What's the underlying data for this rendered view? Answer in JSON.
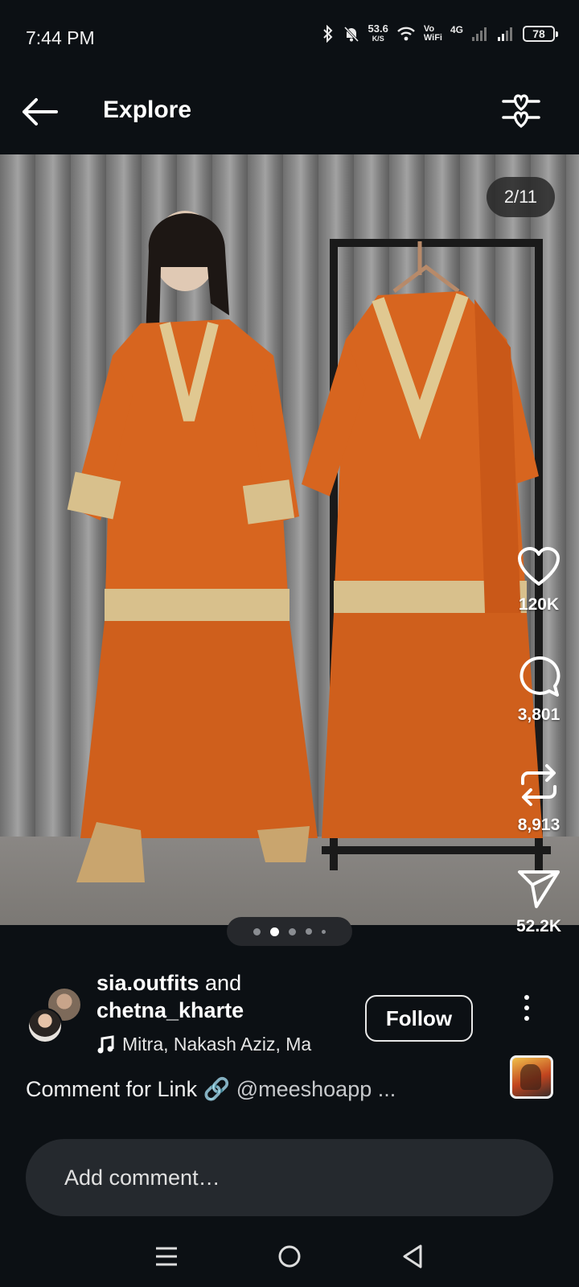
{
  "status_bar": {
    "time": "7:44 PM",
    "net_speed": "53.6",
    "net_unit": "K/S",
    "vo": "Vo",
    "wifi": "WiFi",
    "cell": "4G",
    "battery": "78"
  },
  "header": {
    "title": "Explore"
  },
  "media": {
    "page_indicator": "2/11",
    "page_current": 2,
    "page_total": 11
  },
  "actions": {
    "likes": "120K",
    "comments": "3,801",
    "reposts": "8,913",
    "shares": "52.2K"
  },
  "carousel": {
    "dot_count": 5,
    "active_index": 1
  },
  "author": {
    "name_1": "sia.outfits",
    "joiner": "and",
    "name_2": "chetna_kharte",
    "music": "Mitra, Nakash Aziz, Ma",
    "follow_label": "Follow"
  },
  "caption": {
    "text": "Comment for Link 🔗",
    "mention": "@meeshoapp",
    "ellipsis": "..."
  },
  "comment": {
    "placeholder": "Add comment…"
  },
  "icons": {
    "back": "back-arrow-icon",
    "filter": "filter-heart-icon",
    "like": "heart-icon",
    "comment": "comment-bubble-icon",
    "repost": "repost-icon",
    "share": "send-icon",
    "music": "music-note-icon"
  },
  "colors": {
    "background": "#0c1014",
    "garment": "#d7651f",
    "comment_bar": "#25292e"
  }
}
